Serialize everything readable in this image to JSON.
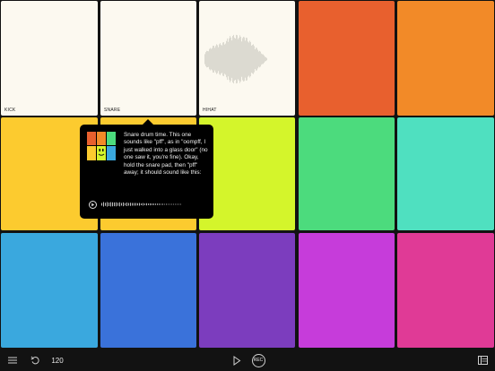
{
  "pads": [
    {
      "id": "kick",
      "label": "KICK",
      "color": "#FCF9F0"
    },
    {
      "id": "snare",
      "label": "SNARE",
      "color": "#FCF9F0"
    },
    {
      "id": "hihat",
      "label": "HIHAT",
      "color": "#FCF9F0"
    },
    {
      "id": "pad-4",
      "label": "",
      "color": "#E8602E"
    },
    {
      "id": "pad-5",
      "label": "",
      "color": "#F28A28"
    },
    {
      "id": "pad-6",
      "label": "",
      "color": "#FCCB2F"
    },
    {
      "id": "pad-7",
      "label": "",
      "color": "#FCCB2F"
    },
    {
      "id": "pad-8",
      "label": "",
      "color": "#D4F52B"
    },
    {
      "id": "pad-9",
      "label": "",
      "color": "#4CDB7D"
    },
    {
      "id": "pad-10",
      "label": "",
      "color": "#4FE0C0"
    },
    {
      "id": "pad-11",
      "label": "",
      "color": "#3AA8DE"
    },
    {
      "id": "pad-12",
      "label": "",
      "color": "#3A72DA"
    },
    {
      "id": "pad-13",
      "label": "",
      "color": "#7C3DBE"
    },
    {
      "id": "pad-14",
      "label": "",
      "color": "#C63CDA"
    },
    {
      "id": "pad-15",
      "label": "",
      "color": "#E03A96"
    }
  ],
  "toolbar": {
    "menu_icon": "hamburger-icon",
    "undo_icon": "undo-icon",
    "tempo": "120",
    "play_icon": "play-icon",
    "rec_label": "REC",
    "library_icon": "list-panel-icon"
  },
  "tooltip": {
    "text": "Snare drum time. This one sounds like \"pff\", as in \"oompff, I just walked into a glass door\" (no one saw it, you're fine). Okay, hold the snare pad, then \"pff\" away; it should sound like this:",
    "play_icon": "play-circle-icon",
    "mascot_colors": [
      "#E8602E",
      "#F28A28",
      "#4CDB7D",
      "#FCCB2F",
      "#D4F52B",
      "#3AA8DE"
    ]
  }
}
